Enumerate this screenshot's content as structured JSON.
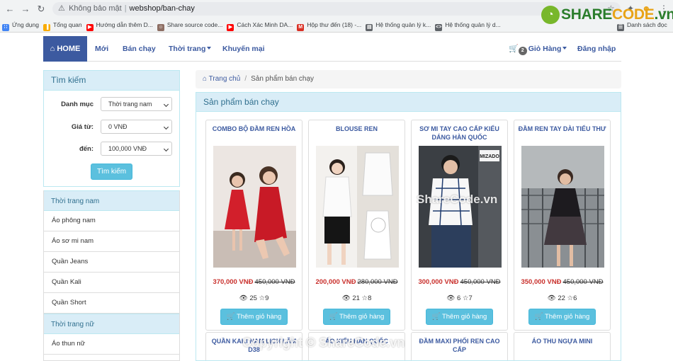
{
  "browser": {
    "security": "Không bảo mật",
    "url": "webshop/ban-chay",
    "bookmarks": [
      {
        "label": "Ứng dụng",
        "icon": "apps-grid-icon",
        "color": "#4285f4"
      },
      {
        "label": "Tổng quan",
        "icon": "analytics-icon",
        "color": "#f9ab00"
      },
      {
        "label": "Hướng dẫn thêm D...",
        "icon": "youtube-icon",
        "color": "#ff0000"
      },
      {
        "label": "Share source code...",
        "icon": "avatar-icon",
        "color": "#8d6e63"
      },
      {
        "label": "Cách Xác Minh DA...",
        "icon": "youtube-icon",
        "color": "#ff0000"
      },
      {
        "label": "Hộp thư đến (18) -...",
        "icon": "gmail-icon",
        "color": "#d93025"
      },
      {
        "label": "Hệ thống quản lý k...",
        "icon": "page-icon",
        "color": "#5f6368"
      },
      {
        "label": "Hệ thống quản lý d...",
        "icon": "code-icon",
        "color": "#5f6368"
      },
      {
        "label": "Danh sách đọc",
        "icon": "reading-list-icon",
        "color": "#5f6368"
      }
    ]
  },
  "logo": {
    "text_main": "SHARE",
    "text_accent": "CODE",
    "text_tail": ".vn",
    "brand_color": "#2a7d2b",
    "accent_color": "#e8a317"
  },
  "navbar": {
    "home": "HOME",
    "items": [
      "Mới",
      "Bán chạy",
      "Thời trang",
      "Khuyến mại"
    ],
    "cart_count": "2",
    "cart_label": "Giỏ Hàng",
    "login": "Đăng nhập",
    "accent": "#3c5aa0"
  },
  "search": {
    "title": "Tìm kiếm",
    "category_label": "Danh mục",
    "category_value": "Thời trang nam",
    "from_label": "Giá từ:",
    "from_value": "0 VNĐ",
    "to_label": "đến:",
    "to_value": "100,000 VNĐ",
    "button": "Tìm kiếm"
  },
  "categories": [
    {
      "title": "Thời trang nam",
      "items": [
        "Áo phông nam",
        "Áo sơ mi nam",
        "Quần Jeans",
        "Quần Kali",
        "Quần Short"
      ]
    },
    {
      "title": "Thời trang nữ",
      "items": [
        "Áo thun nữ"
      ]
    }
  ],
  "breadcrumb": {
    "home": "Trang chủ",
    "current": "Sản phẩm bán chạy"
  },
  "products_title": "Sản phẩm bán chạy",
  "products": [
    {
      "name": "COMBO BỘ ĐẦM REN HỒA",
      "price": "370,000 VNĐ",
      "old_price": "450,000 VNĐ",
      "views": "25",
      "stars": "9",
      "button": "Thêm giỏ hàng"
    },
    {
      "name": "BLOUSE REN",
      "price": "200,000 VNĐ",
      "old_price": "280,000 VNĐ",
      "views": "21",
      "stars": "8",
      "button": "Thêm giỏ hàng"
    },
    {
      "name": "SƠ MI TAY CAO CẤP KIỂU DÁNG HÀN QUỐC",
      "price": "300,000 VNĐ",
      "old_price": "450,000 VNĐ",
      "views": "6",
      "stars": "7",
      "button": "Thêm giỏ hàng"
    },
    {
      "name": "ĐẦM REN TAY DÀI TIỂU THƯ",
      "price": "350,000 VNĐ",
      "old_price": "450,000 VNĐ",
      "views": "22",
      "stars": "6",
      "button": "Thêm giỏ hàng"
    }
  ],
  "products_row2": [
    {
      "name": "QUẦN KAKI NAM LỊCH LÃM D38"
    },
    {
      "name": "ÁO KIỂU HÀN QUỐC"
    },
    {
      "name": "ĐẦM MAXI PHỐI REN CAO CẤP"
    },
    {
      "name": "ÁO THU NGỰA MINI"
    }
  ],
  "watermark": {
    "center": "ShareCode.vn",
    "bottom": "Copyright © ShareCode.vn"
  },
  "photo_brand": "MIZADO"
}
